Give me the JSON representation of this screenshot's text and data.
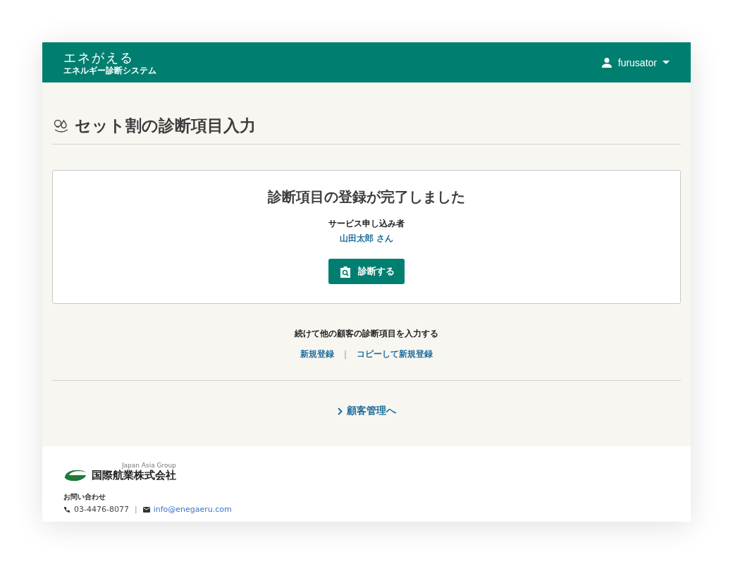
{
  "header": {
    "brand": "エネがえる",
    "subtitle": "エネルギー診断システム",
    "user": "furusator"
  },
  "page_title": "セット割の診断項目入力",
  "result": {
    "heading": "診断項目の登録が完了しました",
    "applicant_label": "サービス申し込み者",
    "applicant_name": "山田太郎 さん",
    "button": "診断する"
  },
  "continue": {
    "label": "続けて他の顧客の診断項目を入力する",
    "links": [
      "新規登録",
      "コピーして新規登録"
    ],
    "separator": "|"
  },
  "back_link": "顧客管理へ",
  "footer": {
    "group": "Japan Asia Group",
    "company": "国際航業株式会社",
    "contact_label": "お問い合わせ",
    "phone": "03-4476-8077",
    "separator": "|",
    "email": "info@enegaeru.com"
  }
}
